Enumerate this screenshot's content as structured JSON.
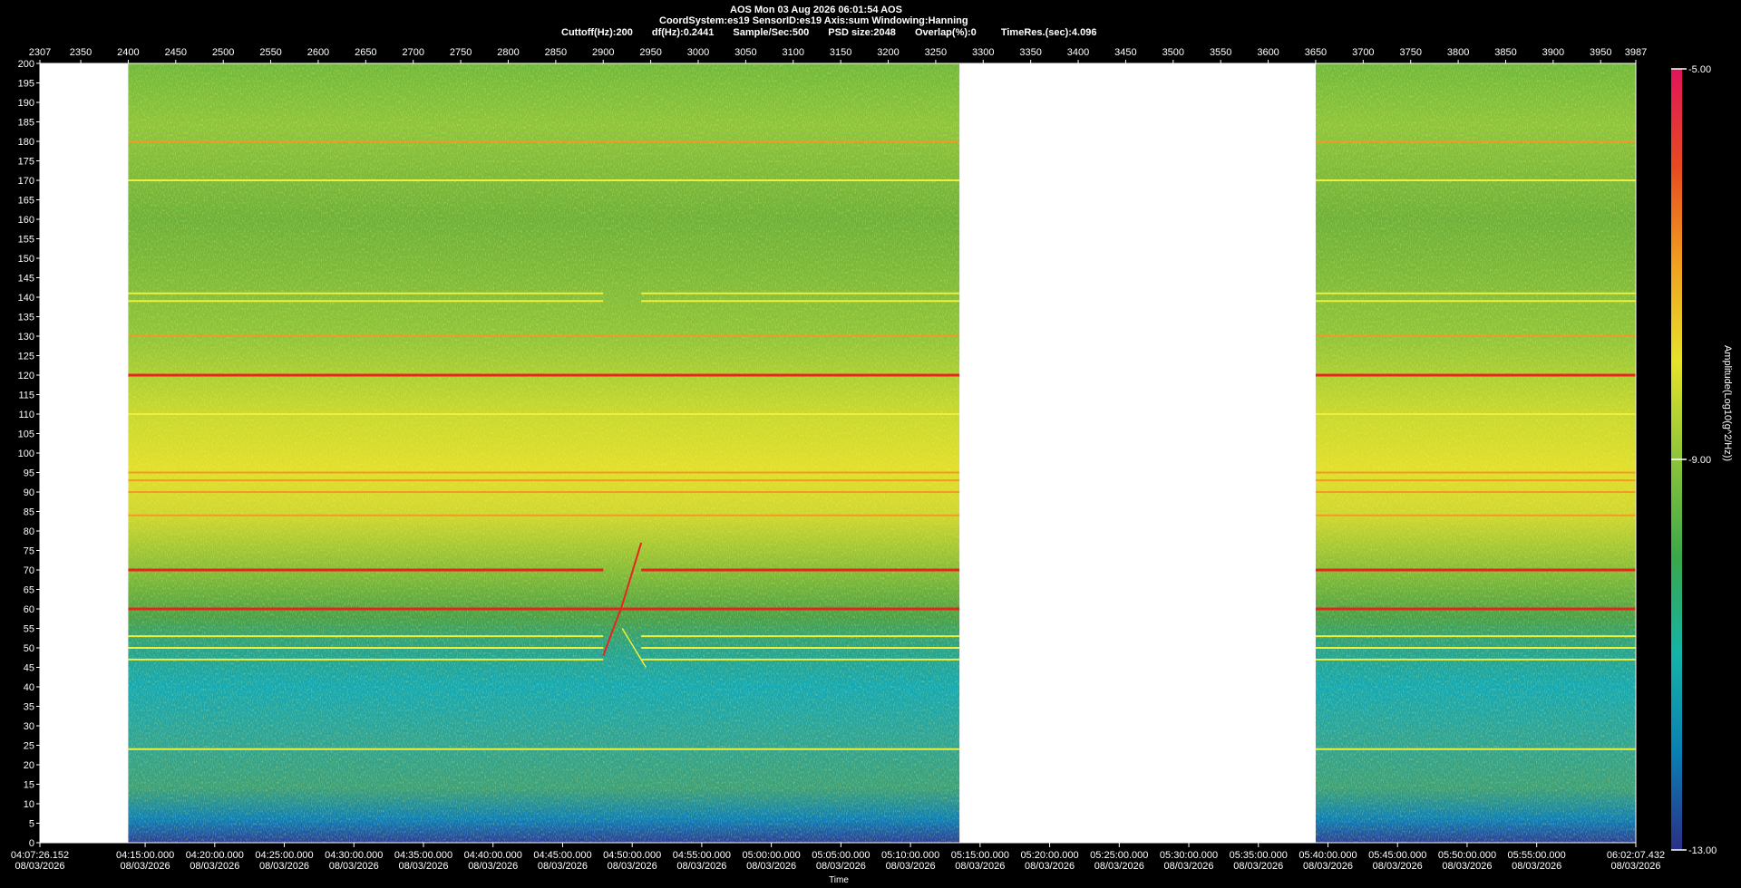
{
  "header": {
    "line1": "AOS  Mon 03 Aug 2026 06:01:54  AOS",
    "line2": "CoordSystem:es19   SensorID:es19    Axis:sum    Windowing:Hanning",
    "line3_items": [
      "Cuttoff(Hz):200",
      "df(Hz):0.2441",
      "Sample/Sec:500",
      "PSD size:2048",
      "Overlap(%):0",
      "TimeRes.(sec):4.096"
    ]
  },
  "chart_data": {
    "type": "heatmap",
    "title": "AOS  Mon 03 Aug 2026 06:01:54  AOS",
    "xlabel": "Time",
    "ylabel": "",
    "colorbar_label": "Amplitude(Log10(g^2/Hz))",
    "ylim": [
      0,
      200
    ],
    "y_ticks": [
      0,
      5,
      10,
      15,
      20,
      25,
      30,
      35,
      40,
      45,
      50,
      55,
      60,
      65,
      70,
      75,
      80,
      85,
      90,
      95,
      100,
      105,
      110,
      115,
      120,
      125,
      130,
      135,
      140,
      145,
      150,
      155,
      160,
      165,
      170,
      175,
      180,
      185,
      190,
      195,
      200
    ],
    "top_axis_range": [
      2307,
      3987
    ],
    "top_ticks": [
      "2307",
      "2350",
      "2400",
      "2450",
      "2500",
      "2550",
      "2600",
      "2650",
      "2700",
      "2750",
      "2800",
      "2850",
      "2900",
      "2950",
      "3000",
      "3050",
      "3100",
      "3150",
      "3200",
      "3250",
      "3300",
      "3350",
      "3400",
      "3450",
      "3500",
      "3550",
      "3600",
      "3650",
      "3700",
      "3750",
      "3800",
      "3850",
      "3900",
      "3950",
      "3987"
    ],
    "time_ticks": [
      {
        "t": "04:07:26.152",
        "d": "08/03/2026"
      },
      {
        "t": "04:15:00.000",
        "d": "08/03/2026"
      },
      {
        "t": "04:20:00.000",
        "d": "08/03/2026"
      },
      {
        "t": "04:25:00.000",
        "d": "08/03/2026"
      },
      {
        "t": "04:30:00.000",
        "d": "08/03/2026"
      },
      {
        "t": "04:35:00.000",
        "d": "08/03/2026"
      },
      {
        "t": "04:40:00.000",
        "d": "08/03/2026"
      },
      {
        "t": "04:45:00.000",
        "d": "08/03/2026"
      },
      {
        "t": "04:50:00.000",
        "d": "08/03/2026"
      },
      {
        "t": "04:55:00.000",
        "d": "08/03/2026"
      },
      {
        "t": "05:00:00.000",
        "d": "08/03/2026"
      },
      {
        "t": "05:05:00.000",
        "d": "08/03/2026"
      },
      {
        "t": "05:10:00.000",
        "d": "08/03/2026"
      },
      {
        "t": "05:15:00.000",
        "d": "08/03/2026"
      },
      {
        "t": "05:20:00.000",
        "d": "08/03/2026"
      },
      {
        "t": "05:25:00.000",
        "d": "08/03/2026"
      },
      {
        "t": "05:30:00.000",
        "d": "08/03/2026"
      },
      {
        "t": "05:35:00.000",
        "d": "08/03/2026"
      },
      {
        "t": "05:40:00.000",
        "d": "08/03/2026"
      },
      {
        "t": "05:45:00.000",
        "d": "08/03/2026"
      },
      {
        "t": "05:50:00.000",
        "d": "08/03/2026"
      },
      {
        "t": "05:55:00.000",
        "d": "08/03/2026"
      },
      {
        "t": "06:02:07.432",
        "d": "08/03/2026"
      }
    ],
    "data_segments": [
      {
        "start_index": 2400,
        "end_index": 3275
      },
      {
        "start_index": 3650,
        "end_index": 3987
      }
    ],
    "colorbar": {
      "min": -13.0,
      "max": -5.0,
      "tick_labels": [
        "-5.00",
        "-9.00",
        "-13.00"
      ],
      "tick_values": [
        -5.0,
        -9.0,
        -13.0
      ],
      "colors": [
        "#2a2f86",
        "#0a7fb3",
        "#14b3a8",
        "#3aa84a",
        "#8cc43a",
        "#e6e32a",
        "#f0a020",
        "#e84a20",
        "#e0145a"
      ]
    },
    "spectral_lines_hz": [
      {
        "hz": 180,
        "level": "orange"
      },
      {
        "hz": 170,
        "level": "yellow"
      },
      {
        "hz": 141,
        "level": "yellow"
      },
      {
        "hz": 139,
        "level": "yellow"
      },
      {
        "hz": 130,
        "level": "orange"
      },
      {
        "hz": 120,
        "level": "red"
      },
      {
        "hz": 110,
        "level": "yellow"
      },
      {
        "hz": 95,
        "level": "orange"
      },
      {
        "hz": 93,
        "level": "orange"
      },
      {
        "hz": 90,
        "level": "orange"
      },
      {
        "hz": 84,
        "level": "orange"
      },
      {
        "hz": 70,
        "level": "red"
      },
      {
        "hz": 60,
        "level": "red"
      },
      {
        "hz": 53,
        "level": "yellow"
      },
      {
        "hz": 50,
        "level": "yellow"
      },
      {
        "hz": 47,
        "level": "yellow"
      },
      {
        "hz": 24,
        "level": "yellow"
      }
    ],
    "sweep_event": {
      "index_start": 2900,
      "index_end": 2960,
      "hz_low": 45,
      "hz_high": 77
    }
  }
}
